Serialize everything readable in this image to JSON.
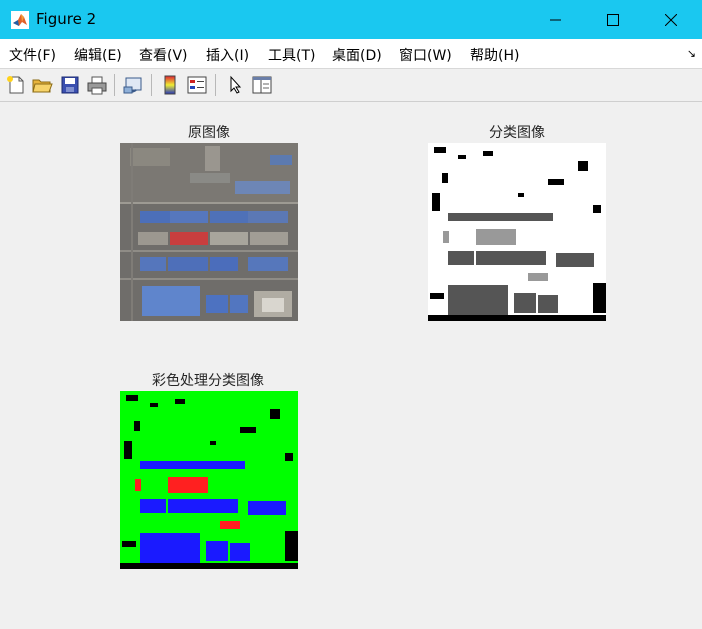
{
  "window": {
    "title": "Figure 2"
  },
  "menu": [
    "文件(F)",
    "编辑(E)",
    "查看(V)",
    "插入(I)",
    "工具(T)",
    "桌面(D)",
    "窗口(W)",
    "帮助(H)"
  ],
  "toolbar": {
    "icons": [
      "new-figure-icon",
      "open-file-icon",
      "save-icon",
      "print-icon",
      "link-plot-icon",
      "colorbar-icon",
      "legend-icon",
      "edit-plot-arrow-icon",
      "property-inspector-icon"
    ]
  },
  "axes": {
    "original": {
      "title": "原图像"
    },
    "classified": {
      "title": "分类图像"
    },
    "color_classified": {
      "title": "彩色处理分类图像"
    }
  },
  "colors": {
    "titlebar": "#1ac8f0",
    "classes_color": [
      "#00ff00",
      "#1a1aff",
      "#ff2020",
      "#000000"
    ],
    "classes_gray": [
      "#ffffff",
      "#555555",
      "#999999",
      "#000000"
    ]
  }
}
